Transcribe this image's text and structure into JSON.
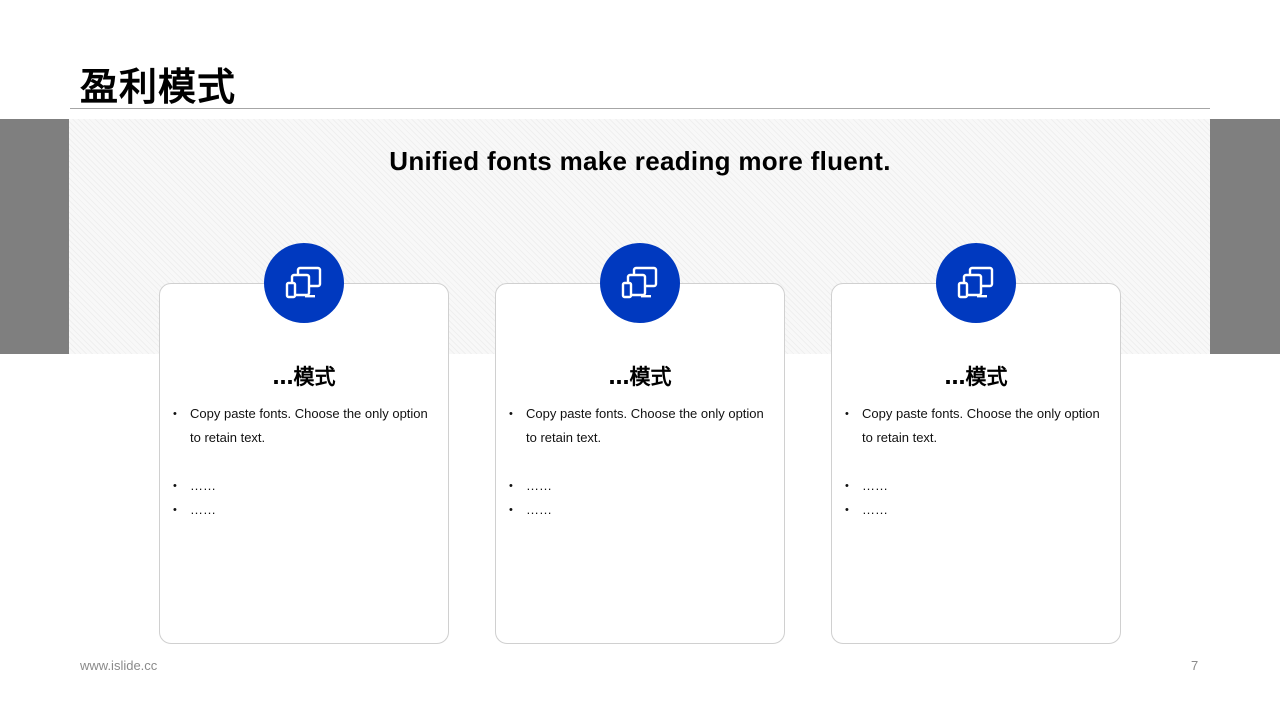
{
  "slide": {
    "title": "盈利模式",
    "subtitle": "Unified fonts make reading more fluent.",
    "footer_url": "www.islide.cc",
    "page_number": "7",
    "accent_color": "#0039bf",
    "side_bar_color": "#7f7f7f"
  },
  "cards": [
    {
      "icon": "devices-icon",
      "title": "…模式",
      "bullets": [
        "Copy paste fonts. Choose the only option to retain text.",
        "……",
        "……"
      ]
    },
    {
      "icon": "devices-icon",
      "title": "…模式",
      "bullets": [
        "Copy paste fonts. Choose the only option to retain text.",
        "……",
        "……"
      ]
    },
    {
      "icon": "devices-icon",
      "title": "…模式",
      "bullets": [
        "Copy paste fonts. Choose the only option to retain text.",
        "……",
        "……"
      ]
    }
  ]
}
